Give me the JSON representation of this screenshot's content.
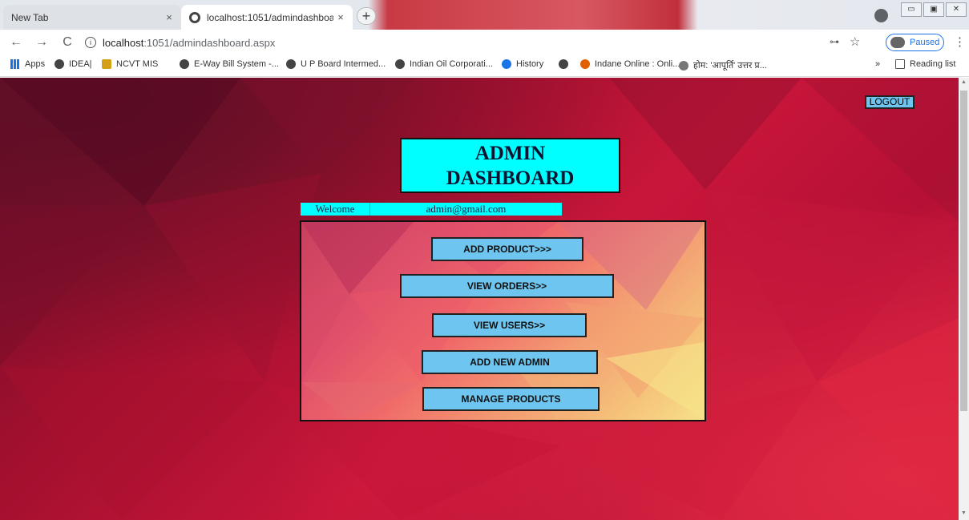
{
  "browser": {
    "tabs": [
      {
        "label": "New Tab",
        "close": "×"
      },
      {
        "label": "localhost:1051/admindashboard",
        "close": "×"
      }
    ],
    "new_tab": "+",
    "window_controls": [
      "▭",
      "▣",
      "✕"
    ],
    "nav": {
      "back": "←",
      "forward": "→",
      "reload": "C",
      "info": "i"
    },
    "address": {
      "host": "localhost",
      "path": ":1051/admindashboard.aspx"
    },
    "key_icon": "⊶",
    "star_icon": "☆",
    "paused_label": "Paused",
    "menu_icon": "⋮",
    "bookmarks": [
      {
        "label": "Apps",
        "icon": "apps-icon"
      },
      {
        "label": "IDEA|",
        "icon": "globe-icon"
      },
      {
        "label": "NCVT MIS",
        "icon": "ncvt-icon"
      },
      {
        "label": "E-Way Bill System -...",
        "icon": "globe-icon"
      },
      {
        "label": "U P Board Intermed...",
        "icon": "globe-icon"
      },
      {
        "label": "Indian Oil Corporati...",
        "icon": "globe-icon"
      },
      {
        "label": "History",
        "icon": "history-icon"
      },
      {
        "label": "",
        "icon": "globe-icon"
      },
      {
        "label": "Indane Online : Onli...",
        "icon": "indane-icon"
      },
      {
        "label": "होम: 'आपूर्ति' उत्तर प्र...",
        "icon": "emblem-icon"
      }
    ],
    "more_bookmarks": "»",
    "reading_list": "Reading list"
  },
  "page": {
    "logout_label": "LOGOUT",
    "title_line1": "ADMIN",
    "title_line2": "DASHBOARD",
    "welcome_label": "Welcome",
    "user_email": "admin@gmail.com",
    "buttons": {
      "add_product": "ADD PRODUCT>>>",
      "view_orders": "VIEW ORDERS>>",
      "view_users": "VIEW USERS>>",
      "add_admin": "ADD NEW ADMIN",
      "manage_products": "MANAGE PRODUCTS"
    }
  },
  "colors": {
    "button_fill": "#6ec6f0",
    "title_fill": "#00ffff",
    "background": "#b50f35"
  }
}
